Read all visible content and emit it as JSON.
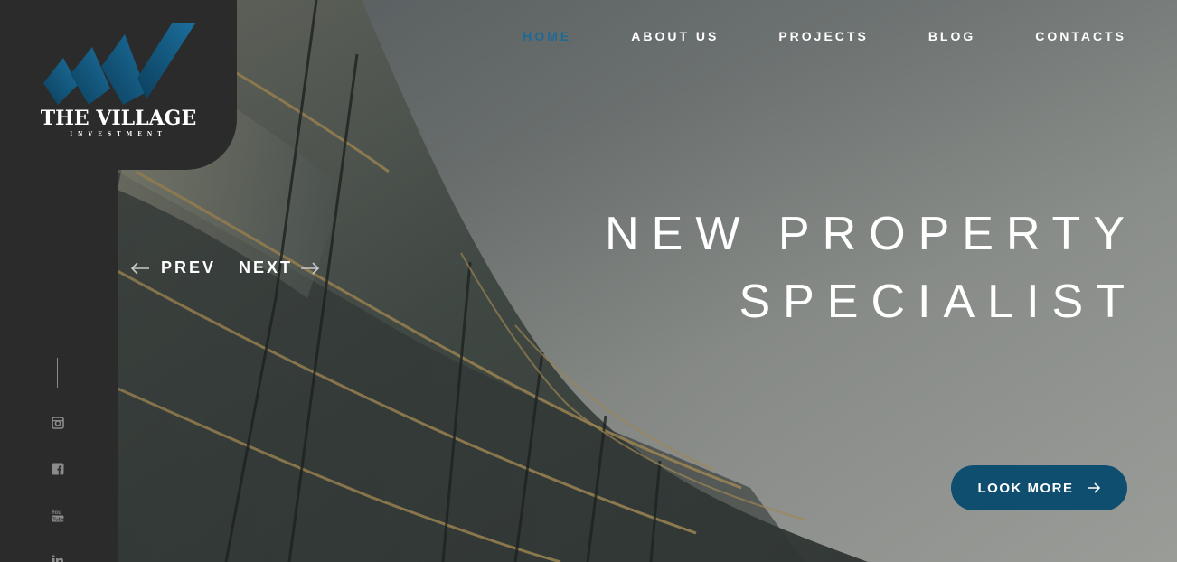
{
  "brand": {
    "name": "THE VILLAGE",
    "tagline": "INVESTMENT",
    "accent_color": "#1e6a95",
    "sidebar_color": "#2b2b2b"
  },
  "nav": {
    "items": [
      {
        "label": "HOME",
        "active": true
      },
      {
        "label": "ABOUT US",
        "active": false
      },
      {
        "label": "PROJECTS",
        "active": false
      },
      {
        "label": "BLOG",
        "active": false
      },
      {
        "label": "CONTACTS",
        "active": false
      }
    ]
  },
  "slider": {
    "prev_label": "PREV",
    "next_label": "NEXT",
    "headline_line1": "NEW PROPERTY",
    "headline_line2": "SPECIALIST",
    "cta_label": "LOOK MORE",
    "cta_color": "#0f4e6f"
  },
  "social": {
    "icons": [
      "instagram-icon",
      "facebook-icon",
      "youtube-icon",
      "linkedin-icon"
    ]
  }
}
